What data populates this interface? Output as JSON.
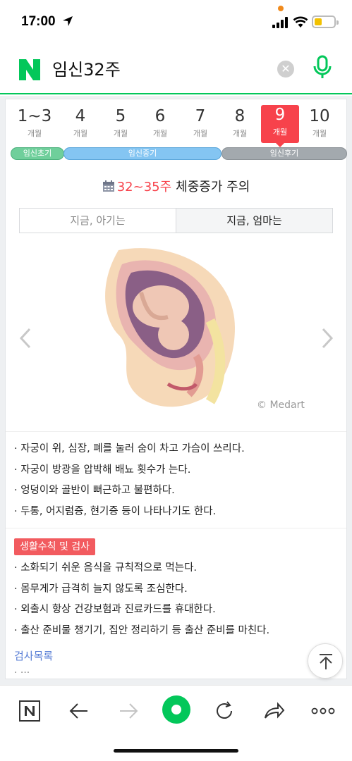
{
  "status_bar": {
    "time": "17:00"
  },
  "search": {
    "logo": "N",
    "query": "임신32주"
  },
  "months": [
    {
      "num": "1~3",
      "unit": "개월"
    },
    {
      "num": "4",
      "unit": "개월"
    },
    {
      "num": "5",
      "unit": "개월"
    },
    {
      "num": "6",
      "unit": "개월"
    },
    {
      "num": "7",
      "unit": "개월"
    },
    {
      "num": "8",
      "unit": "개월"
    },
    {
      "num": "9",
      "unit": "개월"
    },
    {
      "num": "10",
      "unit": "개월"
    }
  ],
  "selected_month": "9",
  "stages": [
    "임신초기",
    "임신중기",
    "임신후기"
  ],
  "headline": {
    "weeks": "32~35주",
    "text": "체중증가 주의"
  },
  "tabs": [
    "지금, 아기는",
    "지금, 엄마는"
  ],
  "credit": "© Medart",
  "symptoms": [
    "· 자궁이 위, 심장, 폐를 눌러 숨이 차고 가슴이 쓰리다.",
    "· 자궁이 방광을 압박해 배뇨 횟수가 는다.",
    "· 엉덩이와 골반이 뻐근하고 불편하다.",
    "· 두통, 어지럼증, 현기증 등이 나타나기도 한다."
  ],
  "lifestyle": {
    "tag": "생활수칙 및 검사",
    "items": [
      "· 소화되기 쉬운 음식을 규칙적으로 먹는다.",
      "· 몸무게가 급격히 늘지 않도록 조심한다.",
      "· 외출시 항상 건강보험과 진료카드를 휴대한다.",
      "· 출산 준비물 챙기기, 집안 정리하기 등 출산 준비를 마친다."
    ],
    "exam_link": "검사목록"
  },
  "colors": {
    "brand_green": "#03c75a",
    "accent_red": "#f7424b"
  },
  "icons": [
    "location-arrow-icon",
    "signal-icon",
    "wifi-icon",
    "battery-icon",
    "clear-icon",
    "mic-icon",
    "calendar-icon",
    "chevron-left-icon",
    "chevron-right-icon",
    "scroll-top-icon",
    "back-icon",
    "forward-icon",
    "reload-icon",
    "share-icon",
    "more-icon"
  ]
}
